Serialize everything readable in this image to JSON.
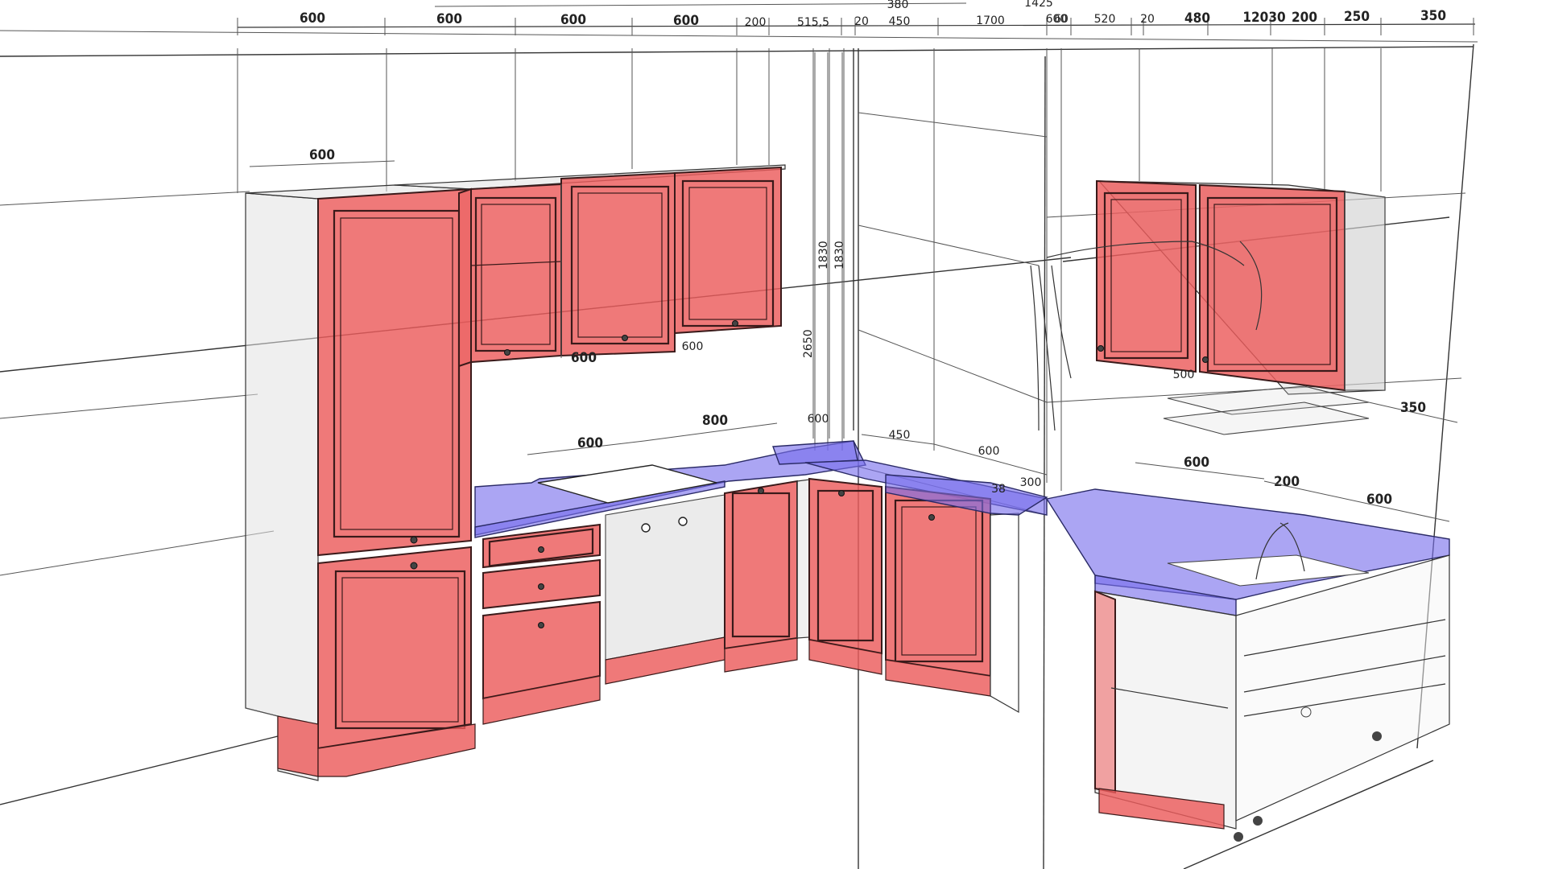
{
  "drawing": {
    "top_dimensions": [
      "600",
      "600",
      "600",
      "600",
      "200",
      "515,5",
      "20",
      "450",
      "1700",
      "600",
      "60",
      "520",
      "20",
      "480",
      "12030",
      "200",
      "250",
      "350"
    ],
    "top_dimensions_upper": [
      "380",
      "1425"
    ],
    "cabinet_dimensions": [
      "600",
      "600",
      "600",
      "800",
      "600",
      "450",
      "600",
      "600",
      "200",
      "600",
      "350",
      "500",
      "600"
    ],
    "small_labels": [
      "38",
      "300"
    ],
    "vertical_dimensions": [
      "1830",
      "1830",
      "2650"
    ]
  },
  "colors": {
    "front": "#ec5c5c",
    "countertop": "#786eeb",
    "carcass": "#e1e1e1",
    "background": "#ffffff"
  }
}
